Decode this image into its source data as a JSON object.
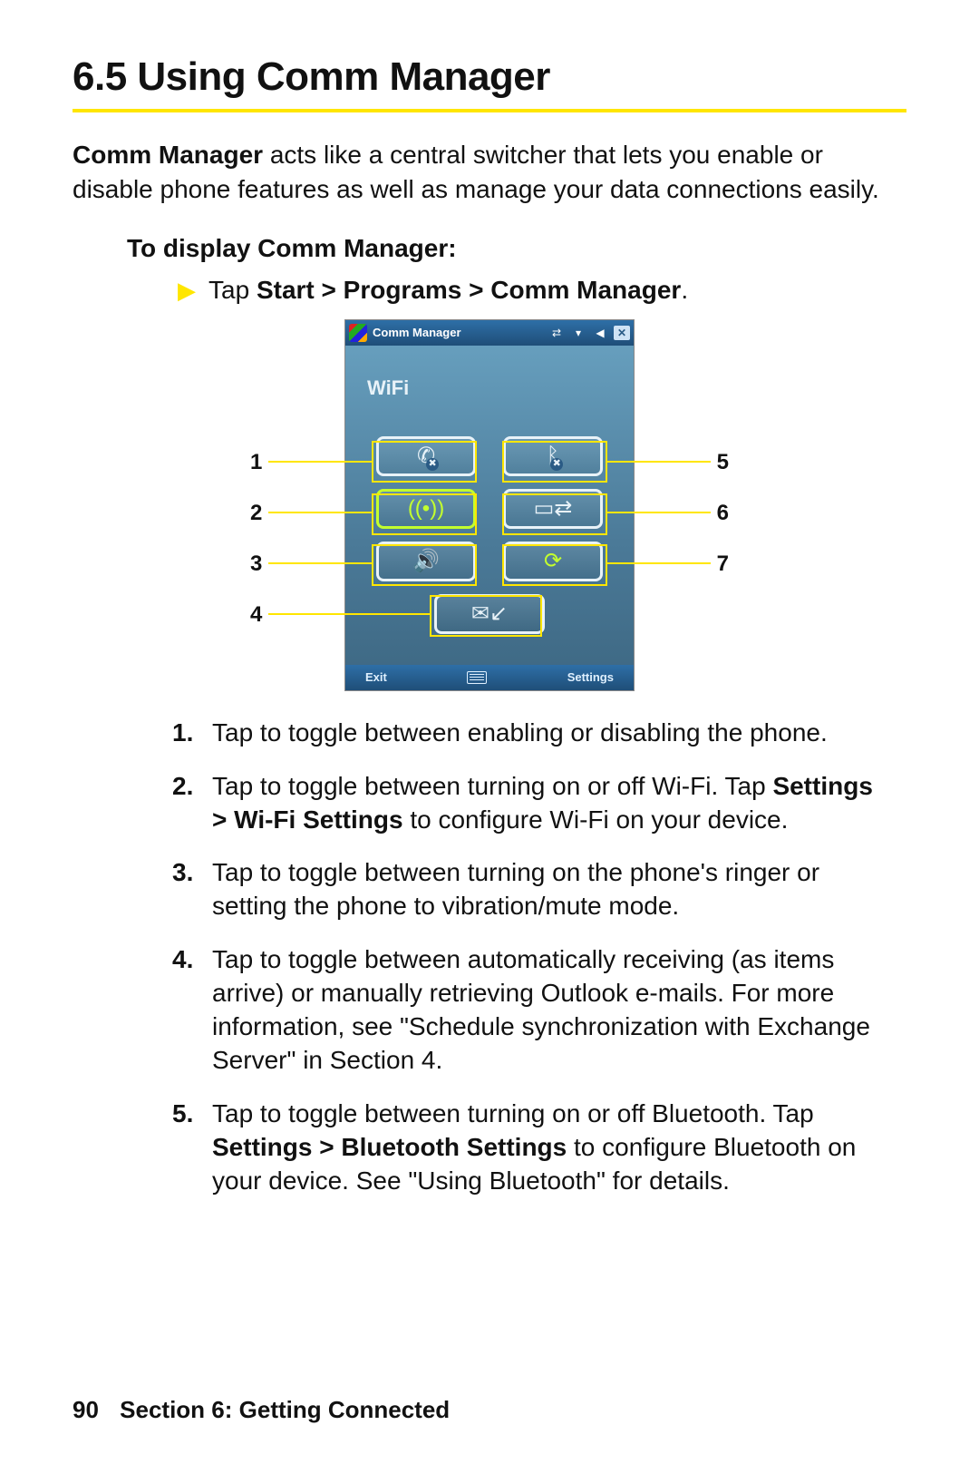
{
  "heading": "6.5   Using Comm Manager",
  "intro_bold": "Comm Manager",
  "intro_rest": " acts like a central switcher that lets you enable or disable phone features as well as manage your data connections easily.",
  "subhead": "To display Comm Manager:",
  "step_prefix": "Tap ",
  "step_bold": "Start > Programs > Comm Manager",
  "step_suffix": ".",
  "phone": {
    "title": "Comm Manager",
    "wifi": "WiFi",
    "soft_left": "Exit",
    "soft_right": "Settings"
  },
  "callouts_left": [
    "1",
    "2",
    "3",
    "4"
  ],
  "callouts_right": [
    "5",
    "6",
    "7"
  ],
  "list": [
    {
      "n": "1.",
      "segments": [
        {
          "b": false,
          "t": "Tap to toggle between enabling or disabling the phone."
        }
      ]
    },
    {
      "n": "2.",
      "segments": [
        {
          "b": false,
          "t": "Tap to toggle between turning on or off Wi-Fi. Tap "
        },
        {
          "b": true,
          "t": "Settings > Wi-Fi Settings"
        },
        {
          "b": false,
          "t": " to configure Wi-Fi on your device."
        }
      ]
    },
    {
      "n": "3.",
      "segments": [
        {
          "b": false,
          "t": "Tap to toggle between turning on the phone's ringer or setting the phone to vibration/mute mode."
        }
      ]
    },
    {
      "n": "4.",
      "segments": [
        {
          "b": false,
          "t": "Tap to toggle between automatically receiving (as items arrive) or manually retrieving Outlook e-mails. For more information, see \"Schedule synchronization with Exchange Server\" in Section 4."
        }
      ]
    },
    {
      "n": "5.",
      "segments": [
        {
          "b": false,
          "t": "Tap to toggle between turning on or off Bluetooth. Tap "
        },
        {
          "b": true,
          "t": "Settings > Bluetooth Settings"
        },
        {
          "b": false,
          "t": " to configure Bluetooth on your device. See \"Using Bluetooth\" for details."
        }
      ]
    }
  ],
  "footer_page": "90",
  "footer_section": "Section 6: Getting Connected"
}
